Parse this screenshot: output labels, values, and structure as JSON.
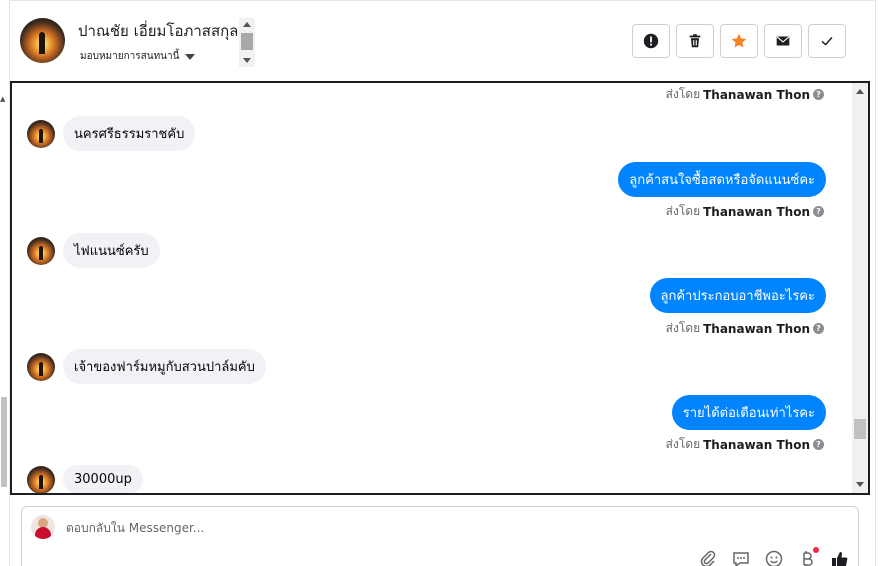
{
  "header": {
    "customer_name": "ปาณชัย เอี่ยมโอภาสสกุล",
    "assign_label": "มอบหมายการสนทนานี้"
  },
  "actions": [
    {
      "name": "mark-spam-button",
      "icon": "alert-icon"
    },
    {
      "name": "delete-button",
      "icon": "trash-icon"
    },
    {
      "name": "star-button",
      "icon": "star-icon"
    },
    {
      "name": "mark-unread-button",
      "icon": "envelope-icon"
    },
    {
      "name": "mark-done-button",
      "icon": "check-icon"
    }
  ],
  "messages": [
    {
      "type": "sent_by",
      "prefix": "ส่งโดย",
      "agent": "Thanawan Thon"
    },
    {
      "type": "in",
      "text": "นครศรีธรรมราชคับ"
    },
    {
      "type": "out",
      "text": "ลูกค้าสนใจซื้อสดหรือจัดแนนซ์คะ"
    },
    {
      "type": "sent_by",
      "prefix": "ส่งโดย",
      "agent": "Thanawan Thon"
    },
    {
      "type": "in",
      "text": "ไฟแนนซ์ครับ"
    },
    {
      "type": "out",
      "text": "ลูกค้าประกอบอาชีพอะไรคะ"
    },
    {
      "type": "sent_by",
      "prefix": "ส่งโดย",
      "agent": "Thanawan Thon"
    },
    {
      "type": "in",
      "text": "เจ้าของฟาร์มหมูกับสวนปาล์มคับ"
    },
    {
      "type": "out",
      "text": "รายได้ต่อเดือนเท่าไรคะ"
    },
    {
      "type": "sent_by",
      "prefix": "ส่งโดย",
      "agent": "Thanawan Thon"
    },
    {
      "type": "in",
      "text": "30000up"
    }
  ],
  "composer": {
    "placeholder": "ตอบกลับใน Messenger..."
  },
  "colors": {
    "outgoing_bubble": "#0084ff",
    "incoming_bubble": "#f0f2f5",
    "star": "#f5821f",
    "notification_dot": "#f02849"
  }
}
